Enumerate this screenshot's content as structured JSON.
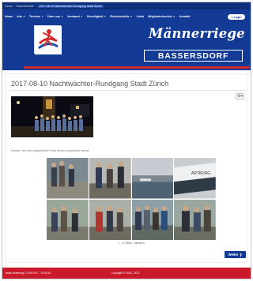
{
  "breadcrumb": {
    "items": [
      "Home",
      "Reiseberichte"
    ],
    "current": "2017-08-10 Nachtwächter-Rundgang Stadt Zürich"
  },
  "nav": {
    "items": [
      {
        "label": "Home",
        "dropdown": false
      },
      {
        "label": "Info",
        "dropdown": true
      },
      {
        "label": "Termine",
        "dropdown": true
      },
      {
        "label": "Über uns",
        "dropdown": true
      },
      {
        "label": "Vorstand",
        "dropdown": true
      },
      {
        "label": "Geselligkeit",
        "dropdown": true
      },
      {
        "label": "Reiseberichte",
        "dropdown": true
      },
      {
        "label": "Links",
        "dropdown": false
      },
      {
        "label": "Mitgliederbereich",
        "dropdown": true
      },
      {
        "label": "Kontakt",
        "dropdown": false
      }
    ],
    "login_label": "Login"
  },
  "brand": {
    "title": "Männerriege",
    "subtitle": "BASSERSDORF"
  },
  "page": {
    "title": "2017-08-10 Nachtwächter-Rundgang Stadt Zürich",
    "caption": "Hinweis: die unten aufgeführten Fotos können vergrössert werden",
    "gallery_caption": "1 - 12 Bilder, Labraheu",
    "next_label": "Weiter"
  },
  "footer": {
    "updated": "letzte Änderung: 12.09.2017 - 10:03:15",
    "copyright": "Copyright © 2002 - 2017"
  },
  "colors": {
    "header_blue": "#133b96",
    "accent_red": "#d22a2a",
    "footer_red": "#c9192a"
  },
  "icons": [
    "caret-down-icon",
    "settings-icon",
    "chevron-right-icon",
    "club-logo"
  ]
}
